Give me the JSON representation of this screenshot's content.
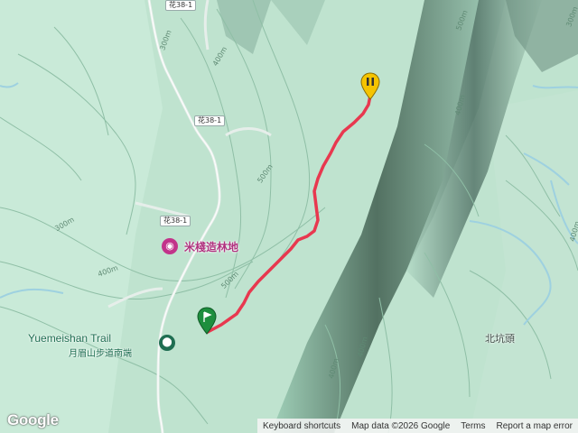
{
  "map": {
    "roads": [
      {
        "label": "花38-1",
        "id": "top"
      },
      {
        "label": "花38-1",
        "id": "mid"
      },
      {
        "label": "花38-1",
        "id": "low"
      }
    ],
    "contours": [
      "300m",
      "400m",
      "500m",
      "400m",
      "300m",
      "500m",
      "500m",
      "400m",
      "300m",
      "400m",
      "400m",
      "400m"
    ],
    "poi": {
      "name": "米棧造林地",
      "icon": "camera-pin-icon",
      "color": "#c2338a"
    },
    "trail": {
      "name_en": "Yuemeishan Trail",
      "name_zh": "月眉山步道南端",
      "icon": "hiker-icon",
      "color": "#1f6e52"
    },
    "place": "北坑頭",
    "route_color": "#e8384f",
    "start_marker_color": "#1e8e3e",
    "end_marker_color": "#f5c400"
  },
  "branding": {
    "logo": "Google"
  },
  "attribution": {
    "shortcuts": "Keyboard shortcuts",
    "data": "Map data ©2026 Google",
    "terms": "Terms",
    "report": "Report a map error"
  }
}
